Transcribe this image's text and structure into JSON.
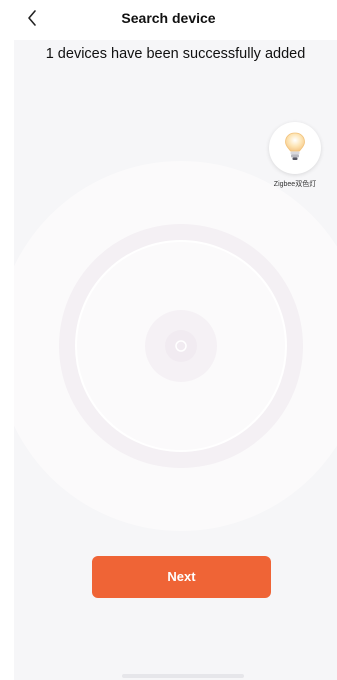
{
  "header": {
    "title": "Search device",
    "back_icon": "chevron-left-icon"
  },
  "status": {
    "message": "1 devices have been successfully added"
  },
  "devices": [
    {
      "name": "Zigbee双色灯",
      "icon": "light-bulb-icon"
    }
  ],
  "actions": {
    "next_label": "Next"
  },
  "colors": {
    "accent": "#ef6436",
    "content_background": "#f6f6f8"
  }
}
